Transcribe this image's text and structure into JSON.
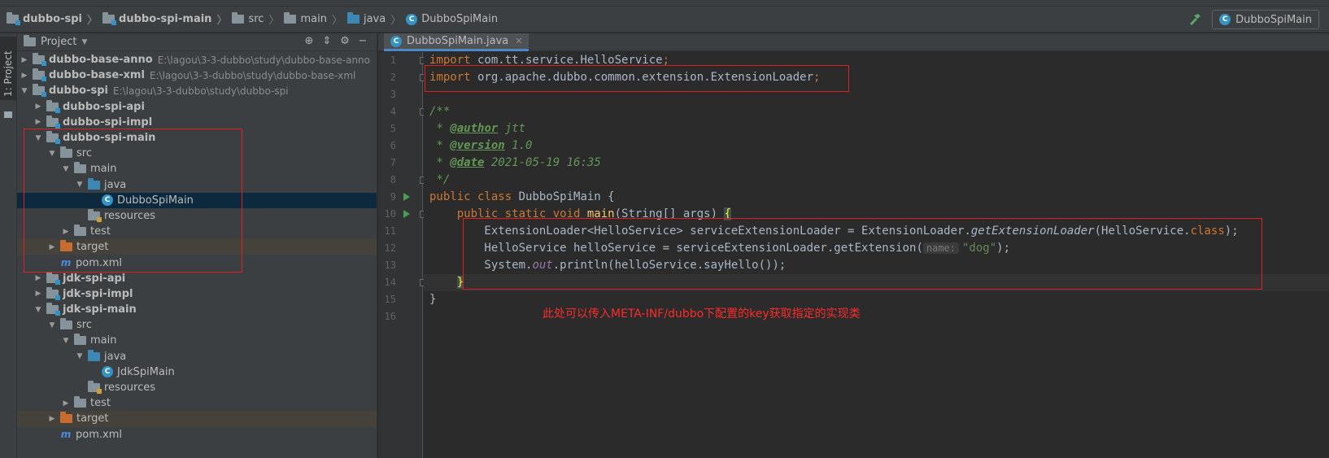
{
  "breadcrumbs": [
    {
      "label": "dubbo-spi",
      "icon": "module-folder-icon",
      "bold": true
    },
    {
      "label": "dubbo-spi-main",
      "icon": "module-folder-icon",
      "bold": true
    },
    {
      "label": "src",
      "icon": "folder-icon",
      "bold": false
    },
    {
      "label": "main",
      "icon": "folder-icon",
      "bold": false
    },
    {
      "label": "java",
      "icon": "source-folder-icon",
      "bold": false
    },
    {
      "label": "DubboSpiMain",
      "icon": "class-icon",
      "bold": false
    }
  ],
  "run_config": {
    "label": "DubboSpiMain"
  },
  "side_stripe": {
    "label": "1: Project"
  },
  "project_panel": {
    "title": "Project"
  },
  "tree": [
    {
      "depth": 0,
      "arrow": "right",
      "icon": "module",
      "name": "dubbo-base-anno",
      "bold": true,
      "path": "E:\\lagou\\3-3-dubbo\\study\\dubbo-base-anno"
    },
    {
      "depth": 0,
      "arrow": "right",
      "icon": "module",
      "name": "dubbo-base-xml",
      "bold": true,
      "path": "E:\\lagou\\3-3-dubbo\\study\\dubbo-base-xml"
    },
    {
      "depth": 0,
      "arrow": "down",
      "icon": "module",
      "name": "dubbo-spi",
      "bold": true,
      "path": "E:\\lagou\\3-3-dubbo\\study\\dubbo-spi"
    },
    {
      "depth": 1,
      "arrow": "right",
      "icon": "module",
      "name": "dubbo-spi-api",
      "bold": true,
      "path": ""
    },
    {
      "depth": 1,
      "arrow": "right",
      "icon": "module",
      "name": "dubbo-spi-impl",
      "bold": true,
      "path": ""
    },
    {
      "depth": 1,
      "arrow": "down",
      "icon": "module",
      "name": "dubbo-spi-main",
      "bold": true,
      "path": ""
    },
    {
      "depth": 2,
      "arrow": "down",
      "icon": "folder",
      "name": "src",
      "bold": false,
      "path": ""
    },
    {
      "depth": 3,
      "arrow": "down",
      "icon": "folder",
      "name": "main",
      "bold": false,
      "path": ""
    },
    {
      "depth": 4,
      "arrow": "down",
      "icon": "src",
      "name": "java",
      "bold": false,
      "path": ""
    },
    {
      "depth": 5,
      "arrow": "none",
      "icon": "class",
      "name": "DubboSpiMain",
      "bold": false,
      "path": "",
      "selected": true
    },
    {
      "depth": 4,
      "arrow": "none",
      "icon": "res",
      "name": "resources",
      "bold": false,
      "path": ""
    },
    {
      "depth": 3,
      "arrow": "right",
      "icon": "folder",
      "name": "test",
      "bold": false,
      "path": ""
    },
    {
      "depth": 2,
      "arrow": "right",
      "icon": "target",
      "name": "target",
      "bold": false,
      "path": "",
      "excluded": true
    },
    {
      "depth": 2,
      "arrow": "none",
      "icon": "maven",
      "name": "pom.xml",
      "bold": false,
      "path": ""
    },
    {
      "depth": 1,
      "arrow": "right",
      "icon": "module",
      "name": "jdk-spi-api",
      "bold": true,
      "path": ""
    },
    {
      "depth": 1,
      "arrow": "right",
      "icon": "module",
      "name": "jdk-spi-impl",
      "bold": true,
      "path": ""
    },
    {
      "depth": 1,
      "arrow": "down",
      "icon": "module",
      "name": "jdk-spi-main",
      "bold": true,
      "path": ""
    },
    {
      "depth": 2,
      "arrow": "down",
      "icon": "folder",
      "name": "src",
      "bold": false,
      "path": ""
    },
    {
      "depth": 3,
      "arrow": "down",
      "icon": "folder",
      "name": "main",
      "bold": false,
      "path": ""
    },
    {
      "depth": 4,
      "arrow": "down",
      "icon": "src",
      "name": "java",
      "bold": false,
      "path": ""
    },
    {
      "depth": 5,
      "arrow": "none",
      "icon": "class",
      "name": "JdkSpiMain",
      "bold": false,
      "path": ""
    },
    {
      "depth": 4,
      "arrow": "none",
      "icon": "res",
      "name": "resources",
      "bold": false,
      "path": ""
    },
    {
      "depth": 3,
      "arrow": "right",
      "icon": "folder",
      "name": "test",
      "bold": false,
      "path": ""
    },
    {
      "depth": 2,
      "arrow": "right",
      "icon": "target",
      "name": "target",
      "bold": false,
      "path": "",
      "excluded": true
    },
    {
      "depth": 2,
      "arrow": "none",
      "icon": "maven",
      "name": "pom.xml",
      "bold": false,
      "path": ""
    }
  ],
  "editor": {
    "tab_label": "DubboSpiMain.java",
    "current_line": 14,
    "line_numbers": [
      "1",
      "2",
      "3",
      "4",
      "5",
      "6",
      "7",
      "8",
      "9",
      "10",
      "11",
      "12",
      "13",
      "14",
      "15",
      "16"
    ],
    "run_gutter_lines": [
      9,
      10
    ],
    "code": {
      "l1_kw": "import",
      "l1_rest": " com.tt.service.HelloService",
      "l2_kw": "import",
      "l2_rest": " org.apache.dubbo.common.extension.ExtensionLoader",
      "semi": ";",
      "l4": "/**",
      "l5_star": " * ",
      "l5_tag": "@author",
      "l5_val": " jtt",
      "l6_tag": "@version",
      "l6_val": " 1.0",
      "l7_tag": "@date",
      "l7_val": " 2021-05-19 16:35",
      "l8": " */",
      "l9_kw": "public class",
      "l9_name": " DubboSpiMain",
      "l9_rest": " {",
      "l10_kw": "    public static void",
      "l10_fn": " main",
      "l10_rest": "(String[] args) ",
      "l10_brace": "{",
      "l11_a": "        ExtensionLoader<HelloService> serviceExtensionLoader = ExtensionLoader.",
      "l11_it": "getExtensionLoader",
      "l11_b": "(HelloService.",
      "l11_kw": "class",
      "l11_c": ");",
      "l12_a": "        HelloService helloService = serviceExtensionLoader.getExtension(",
      "l12_hint": "name:",
      "l12_str": "\"dog\"",
      "l12_c": ");",
      "l13_a": "        System.",
      "l13_fld": "out",
      "l13_b": ".println(helloService.sayHello());",
      "l14_pre": "    ",
      "l14_brace": "}",
      "l15": "}"
    }
  },
  "annotation": "此处可以传入META-INF/dubbo下配置的key获取指定的实现类",
  "colors": {
    "annotation_red": "#ff2b2b",
    "selection": "#0d293e",
    "run_green": "#499c54"
  }
}
